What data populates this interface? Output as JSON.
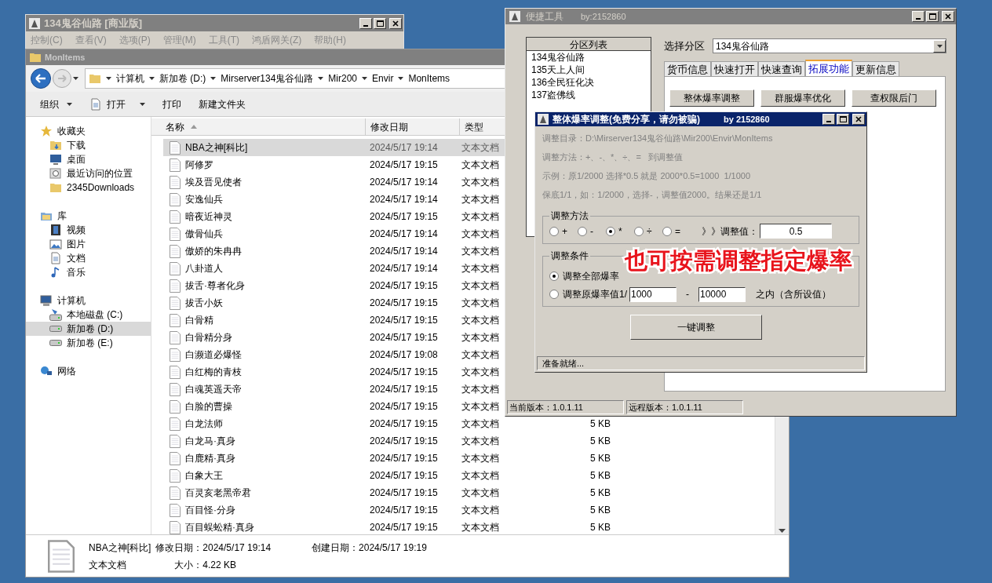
{
  "background_window": {
    "title": "134鬼谷仙路 [商业版]",
    "menu": [
      "控制(C)",
      "查看(V)",
      "选项(P)",
      "管理(M)",
      "工具(T)",
      "鸿盾网关(Z)",
      "帮助(H)"
    ]
  },
  "explorer": {
    "title": "MonItems",
    "breadcrumb": [
      "计算机",
      "新加卷 (D:)",
      "Mirserver134鬼谷仙路",
      "Mir200",
      "Envir",
      "MonItems"
    ],
    "toolbar": [
      {
        "label": "组织",
        "kind": "menu"
      },
      {
        "label": "打开",
        "kind": "open"
      },
      {
        "label": "打印",
        "kind": "plain"
      },
      {
        "label": "新建文件夹",
        "kind": "plain"
      }
    ],
    "nav": [
      {
        "label": "收藏夹",
        "kind": "star",
        "selected": false,
        "children": [
          {
            "label": "下载",
            "kind": "download",
            "selected": false
          },
          {
            "label": "桌面",
            "kind": "desktop",
            "selected": false
          },
          {
            "label": "最近访问的位置",
            "kind": "recent",
            "selected": false
          },
          {
            "label": "2345Downloads",
            "kind": "folder",
            "selected": false
          }
        ]
      },
      {
        "label": "库",
        "kind": "library",
        "selected": false,
        "children": [
          {
            "label": "视频",
            "kind": "video",
            "selected": false
          },
          {
            "label": "图片",
            "kind": "picture",
            "selected": false
          },
          {
            "label": "文档",
            "kind": "document",
            "selected": false
          },
          {
            "label": "音乐",
            "kind": "music",
            "selected": false
          }
        ]
      },
      {
        "label": "计算机",
        "kind": "computer",
        "selected": false,
        "children": [
          {
            "label": "本地磁盘 (C:)",
            "kind": "system-drive",
            "selected": false
          },
          {
            "label": "新加卷 (D:)",
            "kind": "drive",
            "selected": true
          },
          {
            "label": "新加卷 (E:)",
            "kind": "drive",
            "selected": false
          }
        ]
      },
      {
        "label": "网络",
        "kind": "network",
        "selected": false
      }
    ],
    "columns": [
      "名称",
      "修改日期",
      "类型"
    ],
    "files": [
      {
        "name": "NBA之神[科比]",
        "modified": "2024/5/17 19:14",
        "type": "文本文档",
        "selected": true
      },
      {
        "name": "阿修罗",
        "modified": "2024/5/17 19:15",
        "type": "文本文档",
        "selected": false
      },
      {
        "name": "埃及晋见使者",
        "modified": "2024/5/17 19:14",
        "type": "文本文档",
        "selected": false
      },
      {
        "name": "安逸仙兵",
        "modified": "2024/5/17 19:14",
        "type": "文本文档",
        "selected": false
      },
      {
        "name": "暗夜近神灵",
        "modified": "2024/5/17 19:15",
        "type": "文本文档",
        "selected": false
      },
      {
        "name": "傲骨仙兵",
        "modified": "2024/5/17 19:14",
        "type": "文本文档",
        "selected": false
      },
      {
        "name": "傲娇的朱冉冉",
        "modified": "2024/5/17 19:14",
        "type": "文本文档",
        "selected": false
      },
      {
        "name": "八卦道人",
        "modified": "2024/5/17 19:14",
        "type": "文本文档",
        "selected": false
      },
      {
        "name": "拔舌·尊者化身",
        "modified": "2024/5/17 19:15",
        "type": "文本文档",
        "selected": false
      },
      {
        "name": "拔舌小妖",
        "modified": "2024/5/17 19:15",
        "type": "文本文档",
        "selected": false
      },
      {
        "name": "白骨精",
        "modified": "2024/5/17 19:15",
        "type": "文本文档",
        "selected": false
      },
      {
        "name": "白骨精分身",
        "modified": "2024/5/17 19:15",
        "type": "文本文档",
        "selected": false
      },
      {
        "name": "白濒道必爆怪",
        "modified": "2024/5/17 19:08",
        "type": "文本文档",
        "selected": false
      },
      {
        "name": "白红梅的青枝",
        "modified": "2024/5/17 19:15",
        "type": "文本文档",
        "selected": false
      },
      {
        "name": "白魂英遥天帝",
        "modified": "2024/5/17 19:15",
        "type": "文本文档",
        "selected": false
      },
      {
        "name": "白脸的曹操",
        "modified": "2024/5/17 19:15",
        "type": "文本文档",
        "selected": false
      },
      {
        "name": "白龙法师",
        "modified": "2024/5/17 19:15",
        "type": "文本文档",
        "size": "5 KB",
        "selected": false
      },
      {
        "name": "白龙马·真身",
        "modified": "2024/5/17 19:15",
        "type": "文本文档",
        "size": "5 KB",
        "selected": false
      },
      {
        "name": "白鹿精·真身",
        "modified": "2024/5/17 19:15",
        "type": "文本文档",
        "size": "5 KB",
        "selected": false
      },
      {
        "name": "白象大王",
        "modified": "2024/5/17 19:15",
        "type": "文本文档",
        "size": "5 KB",
        "selected": false
      },
      {
        "name": "百灵亥老黑帝君",
        "modified": "2024/5/17 19:15",
        "type": "文本文档",
        "size": "5 KB",
        "selected": false
      },
      {
        "name": "百目怪·分身",
        "modified": "2024/5/17 19:15",
        "type": "文本文档",
        "size": "5 KB",
        "selected": false
      },
      {
        "name": "百目蜈蚣精·真身",
        "modified": "2024/5/17 19:15",
        "type": "文本文档",
        "size": "5 KB",
        "selected": false
      }
    ],
    "details": {
      "name": "NBA之神[科比]",
      "type": "文本文档",
      "modified": "修改日期：2024/5/17 19:14",
      "size": "大小：4.22 KB",
      "created": "创建日期：2024/5/17 19:19"
    }
  },
  "tool_window": {
    "title": "便捷工具",
    "author": "by:2152860",
    "list_header": "分区列表",
    "partitions": [
      "134鬼谷仙路",
      "135天上人间",
      "136全民狂化决",
      "137盗佛线"
    ],
    "select_label": "选择分区",
    "select_value": "134鬼谷仙路",
    "tabs": [
      {
        "label": "货币信息",
        "selected": false
      },
      {
        "label": "快速打开",
        "selected": false
      },
      {
        "label": "快速查询",
        "selected": false
      },
      {
        "label": "拓展功能",
        "selected": true
      },
      {
        "label": "更新信息",
        "selected": false
      }
    ],
    "buttons": [
      "整体爆率调整",
      "群服爆率优化",
      "查权限后门"
    ],
    "status": [
      "当前版本：1.0.1.11",
      "远程版本：1.0.1.11"
    ]
  },
  "dialog": {
    "title": "整体爆率调整(免费分享，请勿被骗)",
    "author": "by 2152860",
    "info": [
      "调整目录：D:\\Mirserver134鬼谷仙路\\Mir200\\Envir\\MonItems",
      "调整方法：+、-、*、÷、=   到调整值",
      "示例：原1/2000 选择*0.5 就是 2000*0.5=1000  1/1000",
      "保底1/1，如：1/2000，选择-，调整值2000。结果还是1/1"
    ],
    "method_group": "调整方法",
    "methods": [
      {
        "label": "+",
        "checked": false
      },
      {
        "label": "-",
        "checked": false
      },
      {
        "label": "*",
        "checked": true
      },
      {
        "label": "÷",
        "checked": false
      },
      {
        "label": "=",
        "checked": false
      }
    ],
    "value_label": "》》调整值：",
    "value": "0.5",
    "condition_group": "调整条件",
    "conditions": [
      {
        "kind": "all",
        "label": "调整全部爆率",
        "checked": true
      },
      {
        "kind": "range",
        "label": "调整原爆率值1/",
        "from": "1000",
        "separator": "-",
        "to": "10000",
        "suffix": "之内（含所设值）",
        "checked": false
      }
    ],
    "run_button": "一键调整",
    "status": "准备就绪..."
  },
  "annotation": "也可按需调整指定爆率"
}
